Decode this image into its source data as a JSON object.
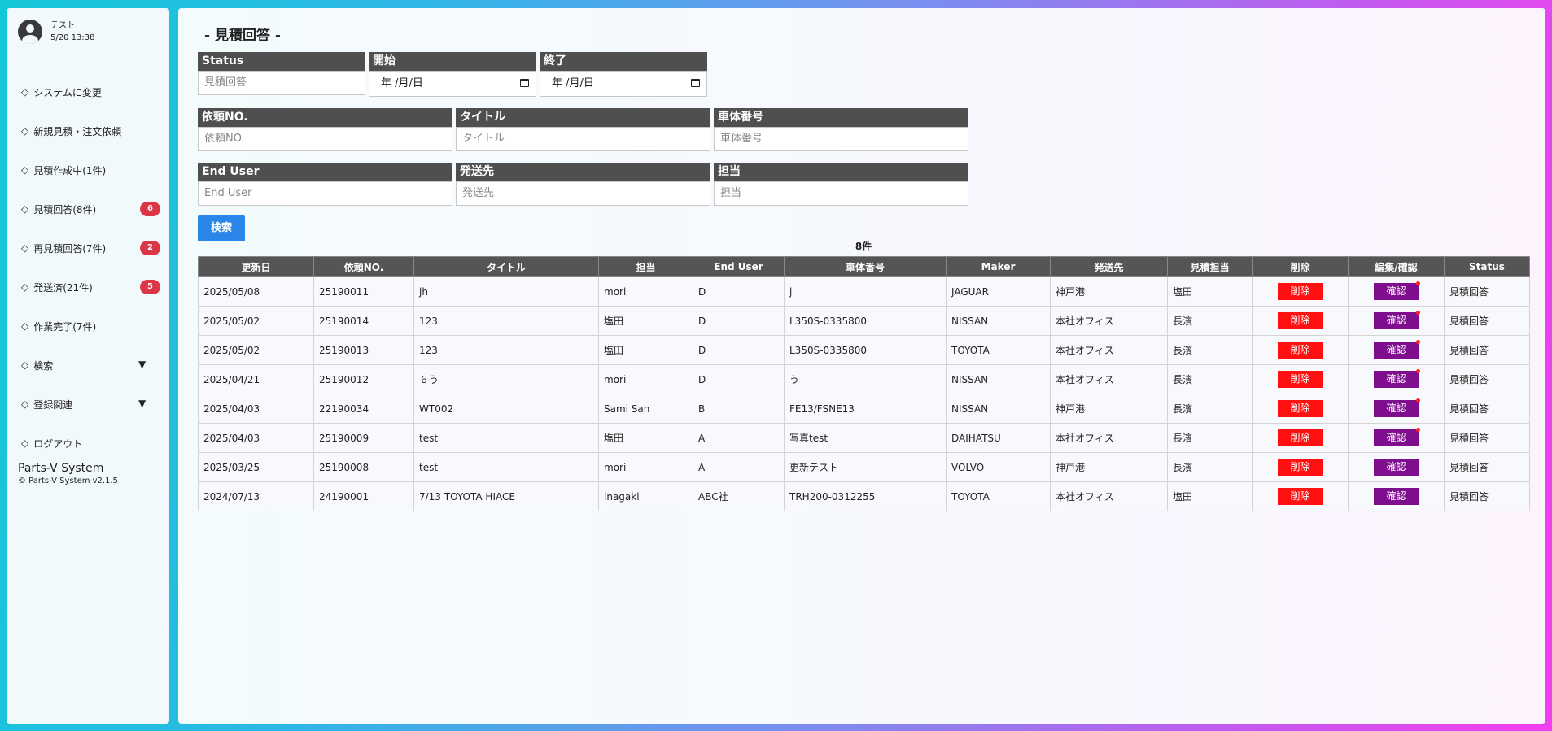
{
  "user": {
    "name": "テスト",
    "datetime": "5/20 13:38"
  },
  "nav": [
    {
      "label": "システムに変更"
    },
    {
      "label": "新規見積・注文依頼"
    },
    {
      "label": "見積作成中(1件)"
    },
    {
      "label": "見積回答(8件)",
      "badge": "6"
    },
    {
      "label": "再見積回答(7件)",
      "badge": "2"
    },
    {
      "label": "発送済(21件)",
      "badge": "5"
    },
    {
      "label": "作業完了(7件)"
    },
    {
      "label": "検索",
      "arrow": "▼"
    },
    {
      "label": "登録関連",
      "arrow": "▼"
    },
    {
      "label": "ログアウト"
    }
  ],
  "nav_marker": "◇",
  "brand": {
    "title": "Parts-V System",
    "copyright": "© Parts-V System v2.1.5"
  },
  "page_title": "- 見積回答 -",
  "filters": {
    "status": {
      "label": "Status",
      "placeholder": "見積回答"
    },
    "start": {
      "label": "開始",
      "value": "年 /月/日"
    },
    "end": {
      "label": "終了",
      "value": "年 /月/日"
    },
    "request_no": {
      "label": "依頼NO.",
      "placeholder": "依頼NO."
    },
    "title": {
      "label": "タイトル",
      "placeholder": "タイトル"
    },
    "vin": {
      "label": "車体番号",
      "placeholder": "車体番号"
    },
    "end_user": {
      "label": "End User",
      "placeholder": "End User"
    },
    "ship_to": {
      "label": "発送先",
      "placeholder": "発送先"
    },
    "person": {
      "label": "担当",
      "placeholder": "担当"
    }
  },
  "search_button": "検索",
  "result_count": "8件",
  "table": {
    "headers": [
      "更新日",
      "依頼NO.",
      "タイトル",
      "担当",
      "End User",
      "車体番号",
      "Maker",
      "発送先",
      "見積担当",
      "削除",
      "編集/確認",
      "Status"
    ],
    "delete_label": "削除",
    "confirm_label": "確認",
    "rows": [
      [
        "2025/05/08",
        "25190011",
        "jh",
        "mori",
        "D",
        "j",
        "JAGUAR",
        "神戸港",
        "塩田",
        "見積回答"
      ],
      [
        "2025/05/02",
        "25190014",
        "123",
        "塩田",
        "D",
        "L350S-0335800",
        "NISSAN",
        "本社オフィス",
        "長濱",
        "見積回答"
      ],
      [
        "2025/05/02",
        "25190013",
        "123",
        "塩田",
        "D",
        "L350S-0335800",
        "TOYOTA",
        "本社オフィス",
        "長濱",
        "見積回答"
      ],
      [
        "2025/04/21",
        "25190012",
        "６う",
        "mori",
        "D",
        "う",
        "NISSAN",
        "本社オフィス",
        "長濱",
        "見積回答"
      ],
      [
        "2025/04/03",
        "22190034",
        "WT002",
        "Sami San",
        "B",
        "FE13/FSNE13",
        "NISSAN",
        "神戸港",
        "長濱",
        "見積回答"
      ],
      [
        "2025/04/03",
        "25190009",
        "test",
        "塩田",
        "A",
        "写真test",
        "DAIHATSU",
        "本社オフィス",
        "長濱",
        "見積回答"
      ],
      [
        "2025/03/25",
        "25190008",
        "test",
        "mori",
        "A",
        "更新テスト",
        "VOLVO",
        "神戸港",
        "長濱",
        "見積回答"
      ],
      [
        "2024/07/13",
        "24190001",
        "7/13 TOYOTA HIACE",
        "inagaki",
        "ABC社",
        "TRH200-0312255",
        "TOYOTA",
        "本社オフィス",
        "塩田",
        "見積回答"
      ]
    ],
    "confirm_dot": [
      true,
      true,
      true,
      true,
      true,
      true,
      false,
      false
    ]
  },
  "colors": {
    "delete": "#ff1111",
    "confirm": "#7e0e8e",
    "badge": "#dc3545",
    "search": "#2a86e8",
    "header": "#555555"
  }
}
